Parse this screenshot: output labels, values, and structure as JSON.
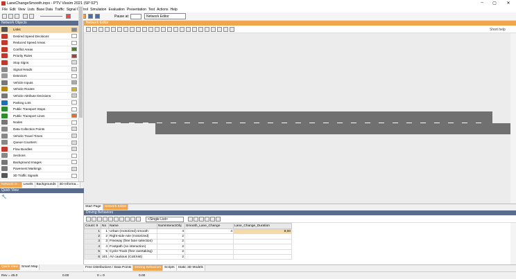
{
  "window": {
    "title": "LaneChangeSmooth.inpx - PTV Vissim 2021 (SP 02*)",
    "controls": [
      "–",
      "▢",
      "✕"
    ]
  },
  "menu": [
    "File",
    "Edit",
    "View",
    "Lists",
    "Base Data",
    "Traffic",
    "Signal Control",
    "Simulation",
    "Evaluation",
    "Presentation",
    "Test",
    "Actions",
    "Help"
  ],
  "toolbar": {
    "pause_label": "Pause at:",
    "mode_select": "Network Editor"
  },
  "network_objects": {
    "header": "Network Objects",
    "items": [
      {
        "label": "Links",
        "selected": true,
        "icon_color": "#555555",
        "swatch": "#888888"
      },
      {
        "label": "Desired Speed Decisions",
        "icon_color": "#c0392b",
        "swatch": "#ffffff"
      },
      {
        "label": "Reduced Speed Areas",
        "icon_color": "#c0392b",
        "swatch": "#ffffff"
      },
      {
        "label": "Conflict Areas",
        "icon_color": "#c0392b",
        "swatch": "#4a7a2a"
      },
      {
        "label": "Priority Rules",
        "icon_color": "#c0392b",
        "swatch": "#a04040"
      },
      {
        "label": "Stop Signs",
        "icon_color": "#c0392b",
        "swatch": "#dddddd"
      },
      {
        "label": "Signal Heads",
        "icon_color": "#888888",
        "swatch": "#dddddd"
      },
      {
        "label": "Detectors",
        "icon_color": "#999999",
        "swatch": "#ffffff"
      },
      {
        "label": "Vehicle Inputs",
        "icon_color": "#777777",
        "swatch": "#aaaaaa"
      },
      {
        "label": "Vehicle Routes",
        "icon_color": "#b8860b",
        "swatch": "#d4b030"
      },
      {
        "label": "Vehicle Attribute Decisions",
        "icon_color": "#777777",
        "swatch": "#cccccc"
      },
      {
        "label": "Parking Lots",
        "icon_color": "#1f6fb5",
        "swatch": "#ffffff"
      },
      {
        "label": "Public Transport Stops",
        "icon_color": "#2e8b2e",
        "swatch": "#ffffff"
      },
      {
        "label": "Public Transport Lines",
        "icon_color": "#2e8b2e",
        "swatch": "#e07030"
      },
      {
        "label": "Nodes",
        "icon_color": "#777777",
        "swatch": "#ffffff"
      },
      {
        "label": "Data Collection Points",
        "icon_color": "#888888",
        "swatch": "#dddddd"
      },
      {
        "label": "Vehicle Travel Times",
        "icon_color": "#888888",
        "swatch": "#dddddd"
      },
      {
        "label": "Queue Counters",
        "icon_color": "#888888",
        "swatch": "#dddddd"
      },
      {
        "label": "Flow Bundles",
        "icon_color": "#c0392b",
        "swatch": "#dddddd"
      },
      {
        "label": "Sections",
        "icon_color": "#888888",
        "swatch": "#ffffff"
      },
      {
        "label": "Background Images",
        "icon_color": "#777777",
        "swatch": "#ffffff"
      },
      {
        "label": "Pavement Markings",
        "icon_color": "#777777",
        "swatch": "#dddddd"
      },
      {
        "label": "3D Traffic Signals",
        "icon_color": "#555555",
        "swatch": "#ffffff"
      }
    ],
    "tabs": [
      "Network O...",
      "Levels",
      "Backgrounds",
      "3D Informa..."
    ]
  },
  "quick_view": {
    "header": "Quick View",
    "tabs": [
      "Quick View",
      "Smart Map"
    ]
  },
  "network_editor": {
    "header": "Network Editor",
    "short_help": "Short help",
    "tabs": [
      "Start Page",
      "Network Editor"
    ],
    "active_tab": "Network Editor"
  },
  "driving_behaviors": {
    "header": "Driving Behaviors",
    "list_select": "<Single List>",
    "columns": [
      "Count: 9",
      "No",
      "Name",
      "NumInteractObj",
      "Smooth_Lane_Change",
      "Lane_Change_Duration"
    ],
    "rows": [
      {
        "idx": "1",
        "no": "1",
        "name": "Urban (motorized) smooth",
        "num": "4",
        "smooth": "4",
        "dur": "8,00",
        "highlight": true
      },
      {
        "idx": "2",
        "no": "2",
        "name": "Right-side rule (motorized)",
        "num": "2",
        "smooth": "",
        "dur": ""
      },
      {
        "idx": "3",
        "no": "3",
        "name": "Freeway (free lane selection)",
        "num": "2",
        "smooth": "",
        "dur": ""
      },
      {
        "idx": "4",
        "no": "4",
        "name": "Footpath (no interaction)",
        "num": "2",
        "smooth": "",
        "dur": ""
      },
      {
        "idx": "5",
        "no": "5",
        "name": "Cycle-Track (free overtaking)",
        "num": "2",
        "smooth": "",
        "dur": ""
      },
      {
        "idx": "6",
        "no": "101",
        "name": "AV cautious (CoEXist)",
        "num": "2",
        "smooth": "",
        "dur": ""
      }
    ],
    "tabs": [
      "Free Distributions / Data Points",
      "Driving Behaviors",
      "Scripts",
      "Static 3D Models"
    ],
    "active_tab": "Driving Behaviors"
  },
  "status": {
    "left": "Rev = 45.0",
    "a": "0.00",
    "b": "0 = 0",
    "c": "0.00"
  }
}
